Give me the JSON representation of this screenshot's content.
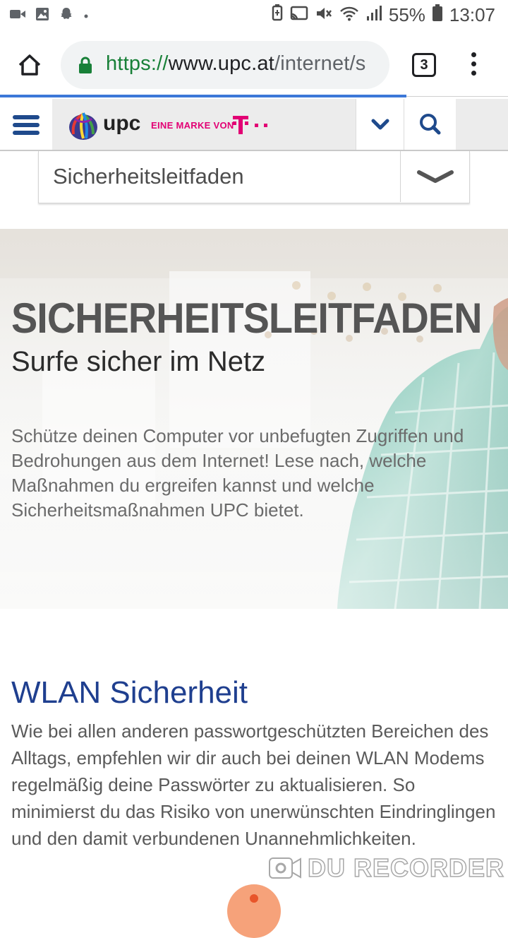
{
  "status_bar": {
    "battery": "55%",
    "time": "13:07",
    "icons": [
      "video-camera-icon",
      "image-icon",
      "snapchat-icon",
      "dot-icon",
      "cast-icon",
      "mute-icon",
      "wifi-icon",
      "signal-icon",
      "battery-icon"
    ]
  },
  "browser": {
    "url_scheme": "https://",
    "url_host": "www.upc.at",
    "url_path": "/internet/s",
    "tab_count": "3",
    "load_progress": 0.8,
    "colors": {
      "secure": "#188038",
      "progress": "#3c78d8"
    }
  },
  "header": {
    "logo_text": "upc",
    "tagline": "EINE MARKE VON",
    "brand_colors": {
      "upc_blue": "#1f4a8c",
      "telekom_magenta": "#e20074"
    }
  },
  "section_dropdown": {
    "selected": "Sicherheitsleitfaden"
  },
  "hero": {
    "title": "SICHERHEITSLEITFADEN",
    "subtitle": "Surfe sicher im Netz",
    "body": "Schütze deinen Computer vor unbefugten Zugriffen und Bedrohungen aus dem Internet! Lese nach, welche Maßnahmen du ergreifen kannst und welche Sicherheitsmaßnahmen UPC bietet."
  },
  "wlan": {
    "title": "WLAN Sicherheit",
    "body": "Wie bei allen anderen passwortgeschützten Bereichen des Alltags, empfehlen wir dir auch bei deinen WLAN Modems regelmäßig deine Passwörter zu aktualisieren. So minimierst du das Risiko von unerwünschten Eindringlingen und den damit verbundenen Unannehmlichkeiten."
  },
  "overlay": {
    "watermark": "DU RECORDER"
  }
}
